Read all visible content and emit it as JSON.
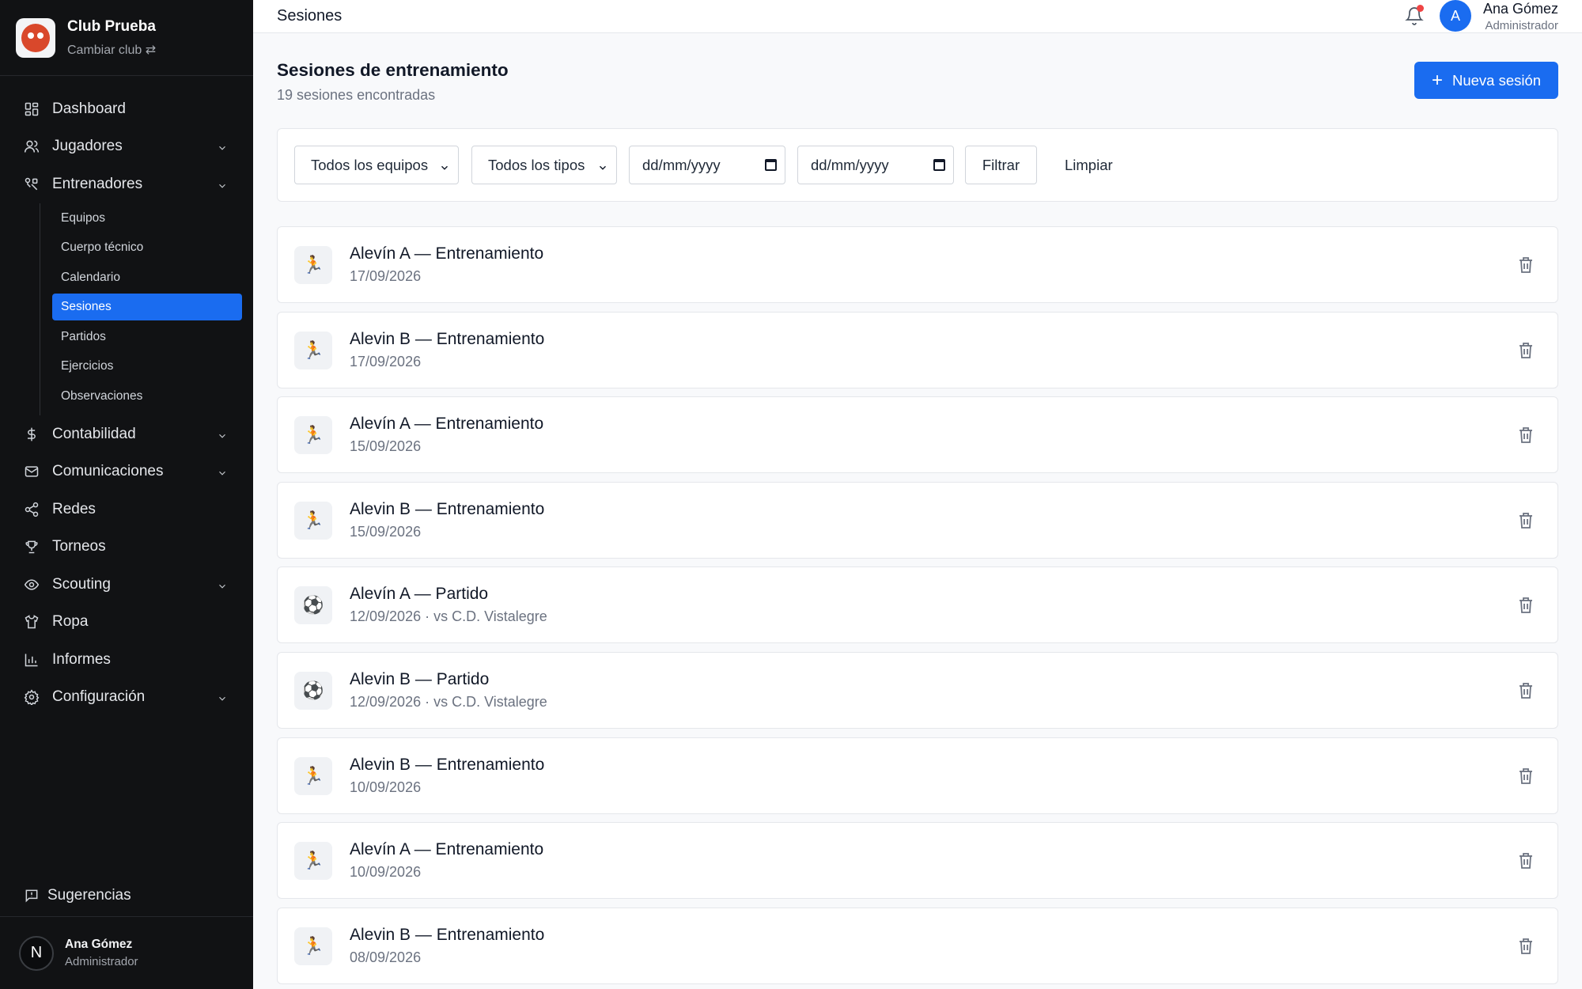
{
  "brand": {
    "name": "Club Prueba",
    "switch_label": "Cambiar club ⇄"
  },
  "nav": {
    "dashboard": "Dashboard",
    "jugadores": "Jugadores",
    "entrenadores": "Entrenadores",
    "entrenadores_sub": [
      "Equipos",
      "Cuerpo técnico",
      "Calendario",
      "Sesiones",
      "Partidos",
      "Ejercicios",
      "Observaciones"
    ],
    "contabilidad": "Contabilidad",
    "comunicaciones": "Comunicaciones",
    "redes": "Redes",
    "torneos": "Torneos",
    "scouting": "Scouting",
    "ropa": "Ropa",
    "informes": "Informes",
    "configuracion": "Configuración",
    "sugerencias": "Sugerencias"
  },
  "sidebar_user": {
    "initial": "N",
    "name": "Ana Gómez",
    "role": "Administrador"
  },
  "topbar": {
    "title": "Sesiones",
    "avatar_initial": "A",
    "user_name": "Ana Gómez",
    "user_role": "Administrador"
  },
  "page": {
    "title": "Sesiones de entrenamiento",
    "count": "19 sesiones encontradas",
    "new_button": "Nueva sesión"
  },
  "filters": {
    "team_select": "Todos los equipos",
    "type_select": "Todos los tipos",
    "date_from": "dd/mm/yyyy",
    "date_to": "dd/mm/yyyy",
    "filter_button": "Filtrar",
    "clear_link": "Limpiar"
  },
  "sessions": [
    {
      "title": "Alevín A — Entrenamiento",
      "subtitle": "17/09/2026",
      "icon": "🏃"
    },
    {
      "title": "Alevin B — Entrenamiento",
      "subtitle": "17/09/2026",
      "icon": "🏃"
    },
    {
      "title": "Alevín A — Entrenamiento",
      "subtitle": "15/09/2026",
      "icon": "🏃"
    },
    {
      "title": "Alevin B — Entrenamiento",
      "subtitle": "15/09/2026",
      "icon": "🏃"
    },
    {
      "title": "Alevín A — Partido",
      "subtitle": "12/09/2026 · vs C.D. Vistalegre",
      "icon": "⚽"
    },
    {
      "title": "Alevin B — Partido",
      "subtitle": "12/09/2026 · vs C.D. Vistalegre",
      "icon": "⚽"
    },
    {
      "title": "Alevin B — Entrenamiento",
      "subtitle": "10/09/2026",
      "icon": "🏃"
    },
    {
      "title": "Alevín A — Entrenamiento",
      "subtitle": "10/09/2026",
      "icon": "🏃"
    },
    {
      "title": "Alevin B — Entrenamiento",
      "subtitle": "08/09/2026",
      "icon": "🏃"
    }
  ]
}
